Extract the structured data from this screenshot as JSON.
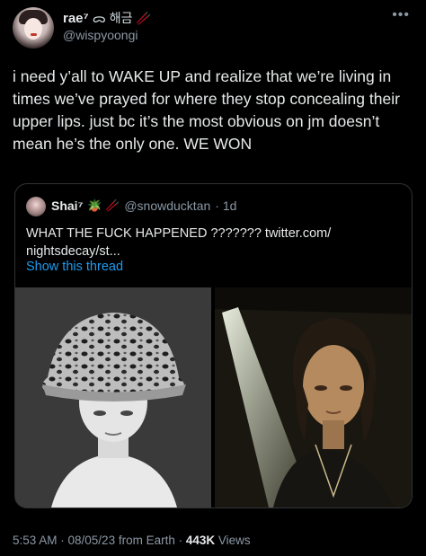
{
  "author": {
    "name": "rae⁷",
    "name_emoji": "ᯅ 해금 🥢",
    "handle": "@wispyoongi"
  },
  "more_label": "•••",
  "tweet": {
    "text": "i need y’all to WAKE UP and realize that we’re living in times we’ve prayed for where they stop concealing their upper lips. just bc it’s the most obvious on jm doesn’t mean he’s the only one. WE WON"
  },
  "quote": {
    "name": "Shai⁷",
    "name_emoji": "🪴 🥢",
    "handle": "@snowducktan",
    "age": "· 1d",
    "text": "WHAT THE FUCK HAPPENED ??????? twitter.com/ nightsdecay/st...",
    "show_thread": "Show this thread"
  },
  "meta": {
    "time": "5:53 AM · 08/05/23 from Earth · ",
    "views_count": "443K",
    "views_label": " Views"
  },
  "colors": {
    "background": "#000000",
    "text": "#e7e9ea",
    "secondary": "#8b98a5",
    "link": "#1d9bf0",
    "border": "#2f3336"
  }
}
